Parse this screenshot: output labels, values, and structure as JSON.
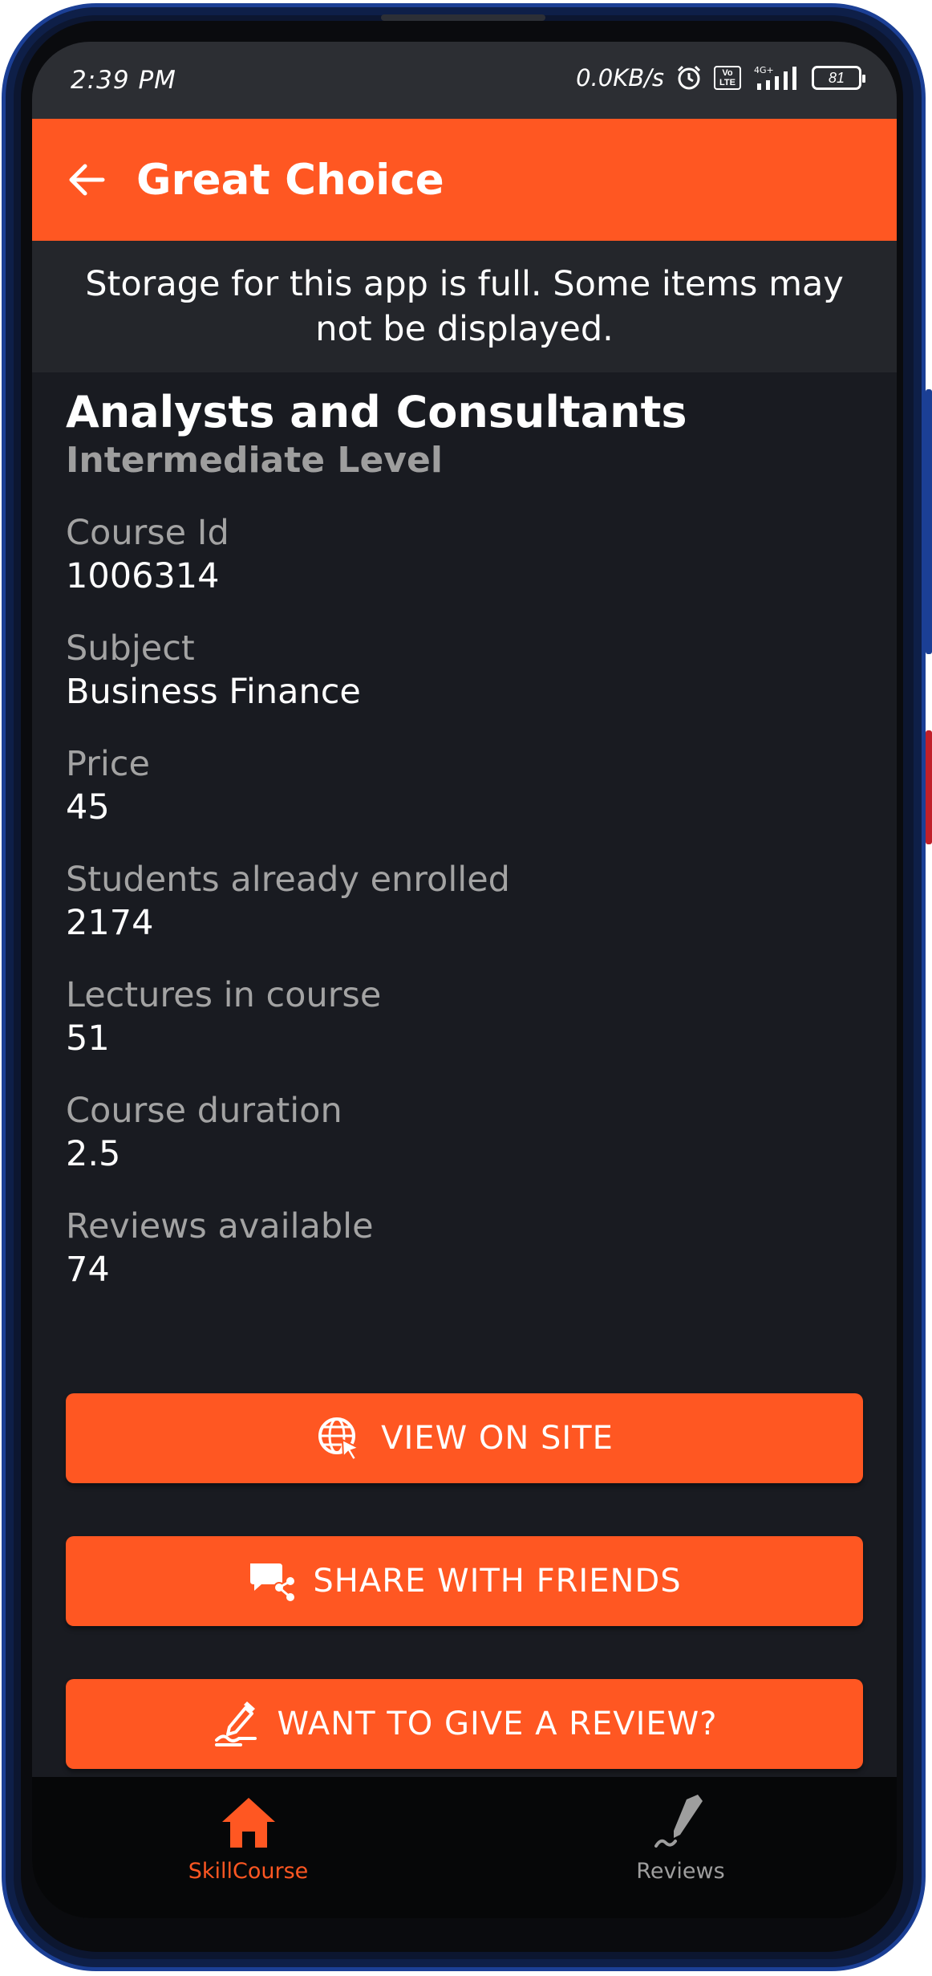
{
  "status_bar": {
    "time": "2:39 PM",
    "net_speed": "0.0KB/s",
    "volte": "Vo LTE",
    "network": "4G+",
    "battery": "81"
  },
  "app_bar": {
    "title": "Great Choice",
    "back_icon": "arrow-left-icon"
  },
  "banner": {
    "line1": "Storage for this app is full. Some items may",
    "line2": "not be displayed."
  },
  "course": {
    "title_line": "Analysts and Consultants",
    "level": "Intermediate Level"
  },
  "fields": [
    {
      "label": "Course Id",
      "value": "1006314"
    },
    {
      "label": "Subject",
      "value": "Business Finance"
    },
    {
      "label": "Price",
      "value": "45"
    },
    {
      "label": "Students already enrolled",
      "value": "2174"
    },
    {
      "label": "Lectures in course",
      "value": "51"
    },
    {
      "label": "Course duration",
      "value": "2.5"
    },
    {
      "label": "Reviews available",
      "value": "74"
    }
  ],
  "buttons": {
    "view_site": {
      "label": "VIEW ON SITE",
      "icon": "globe-cursor-icon"
    },
    "share": {
      "label": "SHARE WITH FRIENDS",
      "icon": "chat-share-icon"
    },
    "review": {
      "label": "WANT TO GIVE A REVIEW?",
      "icon": "pen-sign-icon"
    }
  },
  "bottom_nav": {
    "items": [
      {
        "label": "SkillCourse",
        "icon": "home-icon",
        "active": true
      },
      {
        "label": "Reviews",
        "icon": "pen-icon",
        "active": false
      }
    ]
  },
  "colors": {
    "accent": "#ff5722",
    "background": "#191b21",
    "status_bar": "#2c2e33",
    "banner": "#24262b"
  }
}
